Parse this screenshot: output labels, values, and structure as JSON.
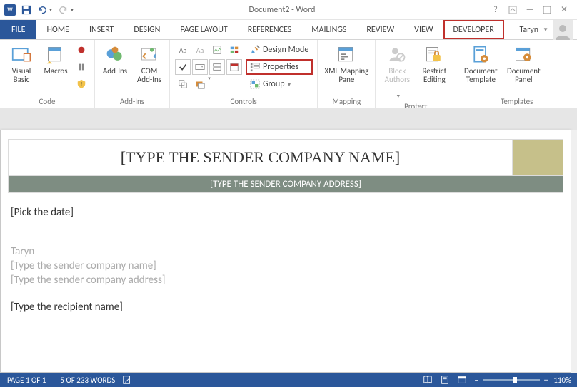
{
  "title": "Document2 - Word",
  "user": {
    "name": "Taryn"
  },
  "tabs": {
    "file": "FILE",
    "home": "HOME",
    "insert": "INSERT",
    "design": "DESIGN",
    "page_layout": "PAGE LAYOUT",
    "references": "REFERENCES",
    "mailings": "MAILINGS",
    "review": "REVIEW",
    "view": "VIEW",
    "developer": "DEVELOPER"
  },
  "ribbon": {
    "code": {
      "label": "Code",
      "visual_basic": "Visual Basic",
      "macros": "Macros"
    },
    "addins": {
      "label": "Add-Ins",
      "addins": "Add-Ins",
      "com": "COM Add-Ins"
    },
    "controls": {
      "label": "Controls",
      "design_mode": "Design Mode",
      "properties": "Properties",
      "group": "Group"
    },
    "mapping": {
      "label": "Mapping",
      "xml": "XML Mapping Pane"
    },
    "protect": {
      "label": "Protect",
      "block": "Block Authors",
      "restrict": "Restrict Editing"
    },
    "templates": {
      "label": "Templates",
      "doctemplate": "Document Template",
      "docpanel": "Document Panel"
    }
  },
  "document": {
    "company_name": "[TYPE THE SENDER COMPANY NAME]",
    "company_address": "[TYPE THE SENDER COMPANY ADDRESS]",
    "pick_date": "[Pick the date]",
    "sender_name": "Taryn",
    "sender_company": "[Type the sender company name]",
    "sender_address": "[Type the sender company address]",
    "recipient": "[Type the recipient name]"
  },
  "status": {
    "page": "PAGE 1 OF 1",
    "words": "5 OF 233 WORDS",
    "zoom_minus": "−",
    "zoom_plus": "+",
    "zoom_pct": "110%"
  }
}
